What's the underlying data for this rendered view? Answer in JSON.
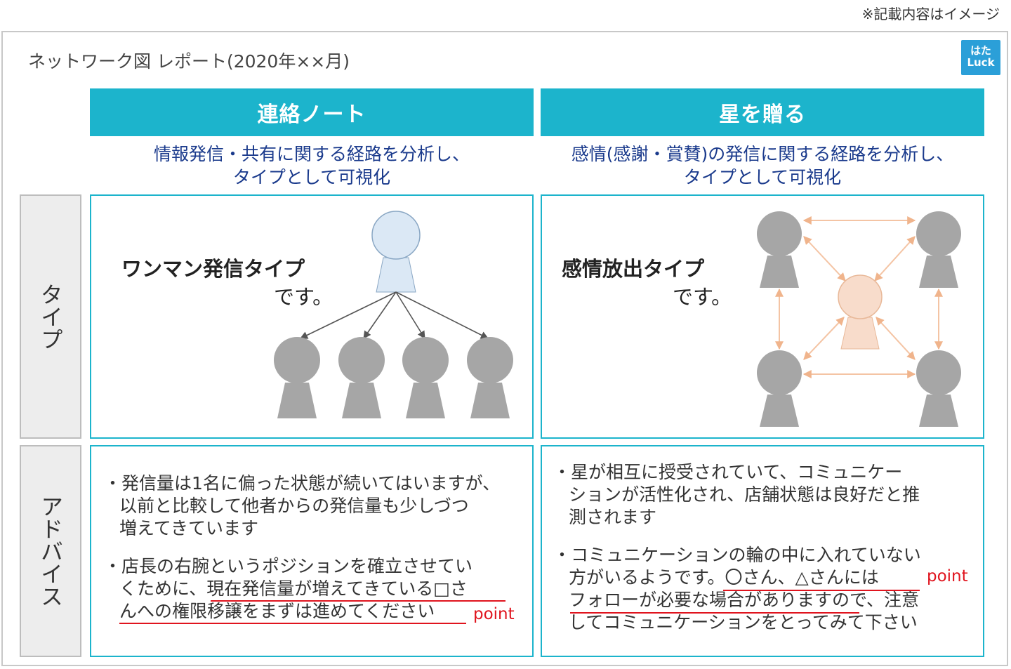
{
  "note": "※記載内容はイメージ",
  "title": "ネットワーク図 レポート(2020年××月)",
  "logo": {
    "line1": "はた",
    "line2": "Luck"
  },
  "columns": [
    {
      "header": "連絡ノート",
      "subtitle_line1": "情報発信・共有に関する経路を分析し、",
      "subtitle_line2": "タイプとして可視化"
    },
    {
      "header": "星を贈る",
      "subtitle_line1": "感情(感謝・賞賛)の発信に関する経路を分析し、",
      "subtitle_line2": "タイプとして可視化"
    }
  ],
  "rows": {
    "type_label": "タイプ",
    "advice_label": "アドバイス"
  },
  "types": [
    {
      "name": "ワンマン発信タイプ",
      "suffix": "です。"
    },
    {
      "name": "感情放出タイプ",
      "suffix": "です。"
    }
  ],
  "advice_left": {
    "b1": [
      "・発信量は1名に偏った状態が続いてはいますが、",
      "以前と比較して他者からの発信量も少しづつ",
      "増えてきています"
    ],
    "b2": [
      "・店長の右腕というポジションを確立させてい",
      "くために、現在発信量が増えてきている□さ",
      "んへの権限移譲をまずは進めてください"
    ],
    "point": "point"
  },
  "advice_right": {
    "b1": [
      "・星が相互に授受されていて、コミュニケー",
      "ションが活性化され、店舗状態は良好だと推",
      "測されます"
    ],
    "b2": [
      "・コミュニケーションの輪の中に入れていない",
      "方がいるようです。〇さん、△さんには",
      "フォローが必要な場合がありますので、注意",
      "してコミュニケーションをとってみて下さい"
    ],
    "point": "point"
  },
  "colors": {
    "accent": "#1cb4cc",
    "subtitle": "#1a3a8c",
    "point": "#e0141e",
    "node_gray": "#a6a6a6",
    "node_blue": "#dbe8f5",
    "node_peach": "#f8dccb",
    "arrow_peach": "#f4c4a4"
  }
}
